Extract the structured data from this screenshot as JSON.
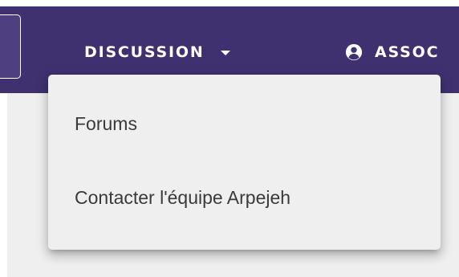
{
  "navbar": {
    "items": [
      {
        "label": "DISCUSSION"
      },
      {
        "label": "ASSOC"
      }
    ]
  },
  "menu": {
    "items": [
      {
        "label": "Forums"
      },
      {
        "label": "Contacter l'équipe Arpejeh"
      }
    ]
  },
  "colors": {
    "navbar": "#3f3170",
    "menu_background": "#efefef",
    "menu_text": "#3a3a3a",
    "nav_text": "#ffffff"
  },
  "icons": {
    "discussion_caret": "caret-down-icon",
    "assoc_icon": "account-circle-icon"
  }
}
